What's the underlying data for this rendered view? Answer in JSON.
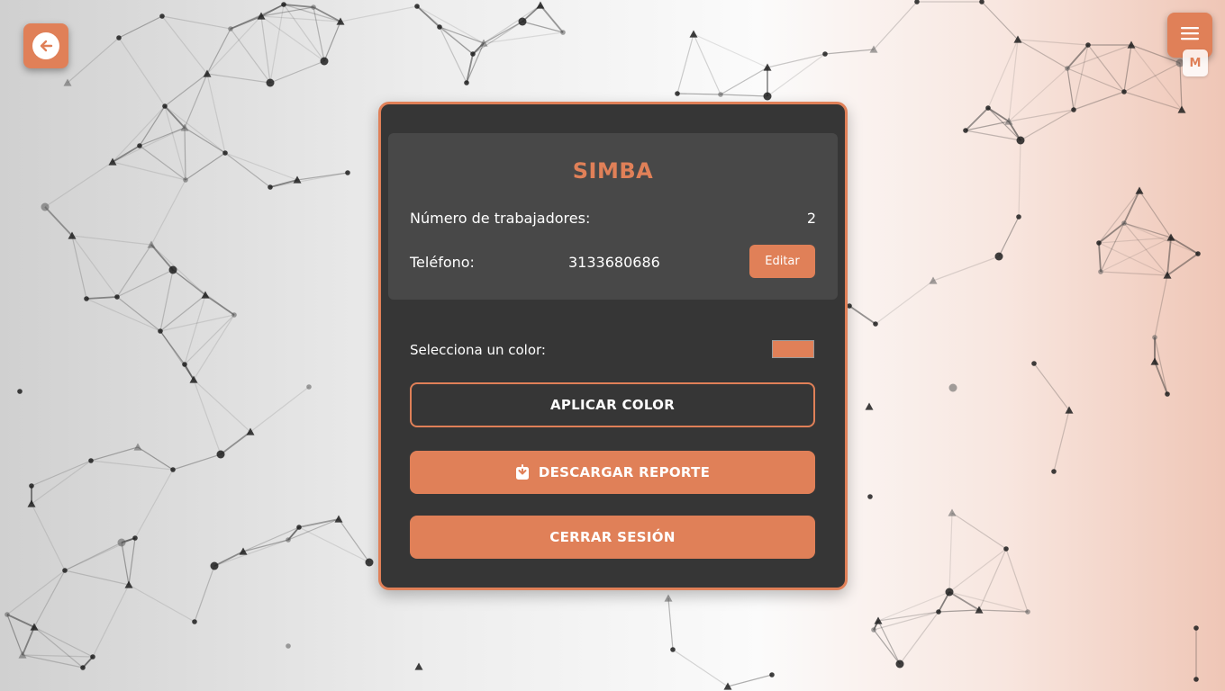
{
  "header": {
    "back_icon": "arrow-left-icon",
    "menu_icon": "hamburger-menu-icon",
    "user_badge": "M"
  },
  "company": {
    "name": "SIMBA",
    "workers_label": "Número de trabajadores:",
    "workers_value": "2",
    "phone_label": "Teléfono:",
    "phone_value": "3133680686",
    "edit_label": "Editar"
  },
  "color_picker": {
    "label": "Selecciona un color:",
    "selected_color": "#e08058"
  },
  "actions": {
    "apply_label": "APLICAR COLOR",
    "download_label": "DESCARGAR REPORTE",
    "download_icon": "download-icon",
    "logout_label": "CERRAR SESIÓN"
  },
  "theme": {
    "accent": "#e08058",
    "panel_bg": "#363636",
    "card_bg": "#484848"
  }
}
